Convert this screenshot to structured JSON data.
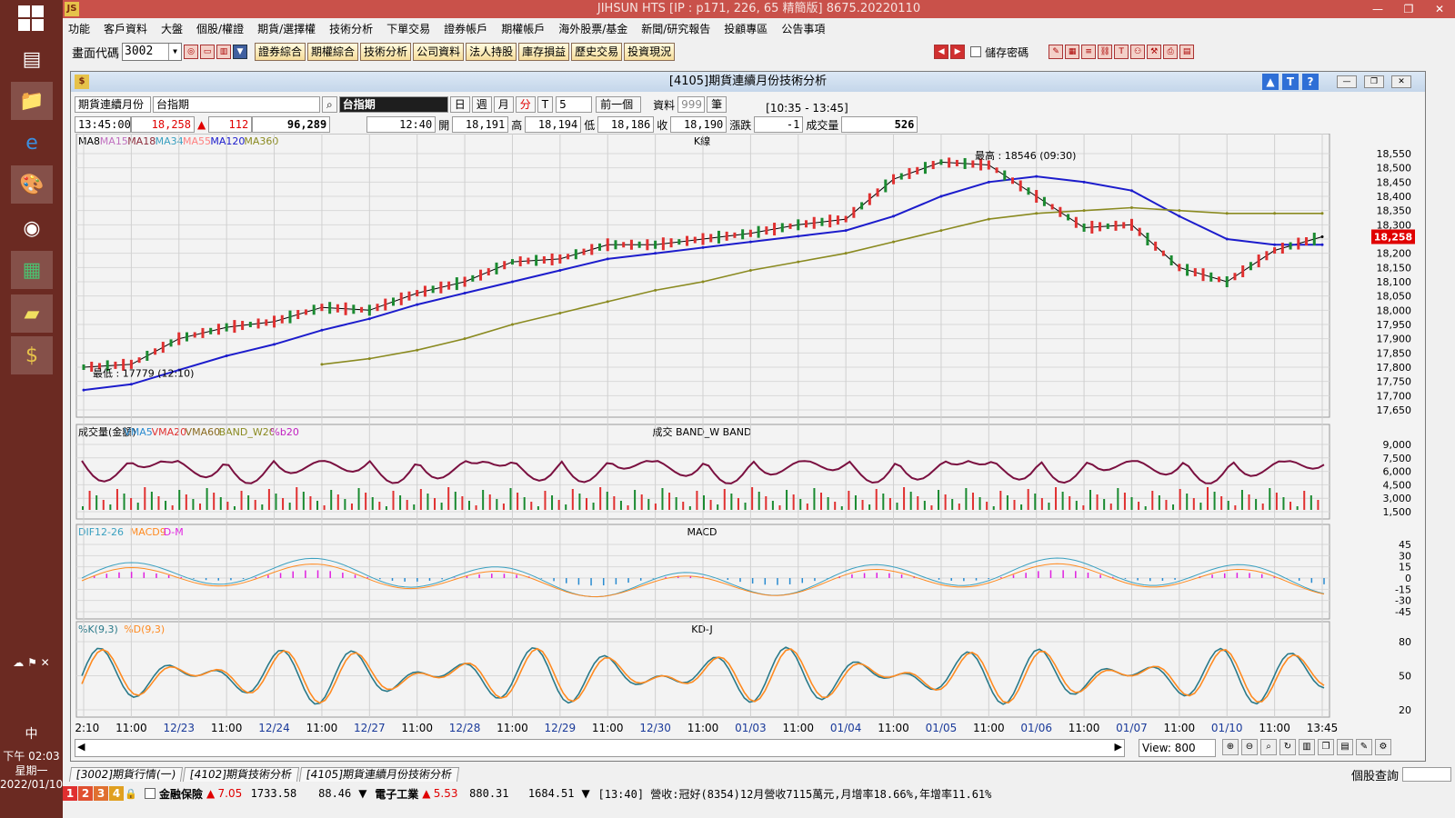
{
  "taskbar": {
    "time": "下午 02:03",
    "weekday": "星期一",
    "date": "2022/01/10",
    "ime": "中"
  },
  "app": {
    "title": "JIHSUN HTS     [IP : p171, 226, 65 精簡版] 8675.20220110",
    "logo": "JS"
  },
  "menu": [
    "功能",
    "客戶資料",
    "大盤",
    "個股/權證",
    "期貨/選擇權",
    "技術分析",
    "下單交易",
    "證券帳戶",
    "期權帳戶",
    "海外股票/基金",
    "新聞/研究報告",
    "投顧專區",
    "公告事項"
  ],
  "toolbar": {
    "code_label": "畫面代碼",
    "code_value": "3002",
    "buttons": [
      "證券綜合",
      "期權綜合",
      "技術分析",
      "公司資料",
      "法人持股",
      "庫存損益",
      "歷史交易",
      "投資現況"
    ],
    "save_pw": "儲存密碼"
  },
  "window": {
    "title": "[4105]期貨連續月份技術分析",
    "help_buttons": [
      "▲",
      "T",
      "?"
    ]
  },
  "controls": {
    "product_type": "期貨連續月份",
    "product_name": "台指期",
    "product_display": "台指期",
    "periods": [
      "日",
      "週",
      "月",
      "分",
      "T"
    ],
    "minutes": "5",
    "prev": "前一個",
    "data_label": "資料",
    "data_count": "999",
    "data_unit": "筆",
    "range": "[10:35 - 13:45]"
  },
  "quote": {
    "time": "13:45:00",
    "price": "18,258",
    "arrow": "▲",
    "change": "112",
    "volume_total": "96,289",
    "bar_time": "12:40",
    "open_label": "開",
    "open": "18,191",
    "high_label": "高",
    "high": "18,194",
    "low_label": "低",
    "low": "18,186",
    "close_label": "收",
    "close": "18,190",
    "chg_label": "漲跌",
    "chg": "-1",
    "vol_label": "成交量",
    "vol": "526"
  },
  "panels": {
    "price": {
      "title": "K線",
      "legend": [
        "MA8",
        "MA15",
        "MA18",
        "MA34",
        "MA55",
        "MA120",
        "MA360"
      ],
      "colors": [
        "#000000",
        "#c070c0",
        "#8b2a3a",
        "#3aa0c0",
        "#ff8080",
        "#1c1ccc",
        "#8a8a20"
      ],
      "high_note": "最高 : 18546 (09:30)",
      "low_note": "最低 : 17779 (12:10)",
      "last_price": "18,258",
      "yticks": [
        "18,550",
        "18,500",
        "18,450",
        "18,400",
        "18,350",
        "18,300",
        "18,250",
        "18,200",
        "18,150",
        "18,100",
        "18,050",
        "18,000",
        "17,950",
        "17,900",
        "17,850",
        "17,800",
        "17,750",
        "17,700",
        "17,650"
      ]
    },
    "volume": {
      "title": "成交   BAND_W   BAND",
      "legend": [
        "成交量(金額)",
        "VMA5",
        "VMA20",
        "VMA60",
        "BAND_W20",
        "%b20"
      ],
      "colors": [
        "#000000",
        "#2a8bd0",
        "#e03030",
        "#8a6a20",
        "#8a8a20",
        "#c020c0"
      ],
      "yticks": [
        "9,000",
        "7,500",
        "6,000",
        "4,500",
        "3,000",
        "1,500"
      ]
    },
    "macd": {
      "title": "MACD",
      "legend": [
        "DIF12-26",
        "MACD9",
        "D-M"
      ],
      "colors": [
        "#3aa0c0",
        "#ff8a20",
        "#e020e0"
      ],
      "yticks": [
        "45",
        "30",
        "15",
        "0",
        "-15",
        "-30",
        "-45"
      ]
    },
    "kd": {
      "title": "KD-J",
      "legend": [
        "%K(9,3)",
        "%D(9,3)"
      ],
      "colors": [
        "#2a7a8a",
        "#ff8a20"
      ],
      "yticks": [
        "80",
        "50",
        "20"
      ]
    }
  },
  "xaxis": [
    {
      "t": "12:10",
      "c": "#000"
    },
    {
      "t": "11:00",
      "c": "#000"
    },
    {
      "t": "12/23",
      "c": "#1a3a9a"
    },
    {
      "t": "11:00",
      "c": "#000"
    },
    {
      "t": "12/24",
      "c": "#1a3a9a"
    },
    {
      "t": "11:00",
      "c": "#000"
    },
    {
      "t": "12/27",
      "c": "#1a3a9a"
    },
    {
      "t": "11:00",
      "c": "#000"
    },
    {
      "t": "12/28",
      "c": "#1a3a9a"
    },
    {
      "t": "11:00",
      "c": "#000"
    },
    {
      "t": "12/29",
      "c": "#1a3a9a"
    },
    {
      "t": "11:00",
      "c": "#000"
    },
    {
      "t": "12/30",
      "c": "#1a3a9a"
    },
    {
      "t": "11:00",
      "c": "#000"
    },
    {
      "t": "01/03",
      "c": "#1a3a9a"
    },
    {
      "t": "11:00",
      "c": "#000"
    },
    {
      "t": "01/04",
      "c": "#1a3a9a"
    },
    {
      "t": "11:00",
      "c": "#000"
    },
    {
      "t": "01/05",
      "c": "#1a3a9a"
    },
    {
      "t": "11:00",
      "c": "#000"
    },
    {
      "t": "01/06",
      "c": "#1a3a9a"
    },
    {
      "t": "11:00",
      "c": "#000"
    },
    {
      "t": "01/07",
      "c": "#1a3a9a"
    },
    {
      "t": "11:00",
      "c": "#000"
    },
    {
      "t": "01/10",
      "c": "#1a3a9a"
    },
    {
      "t": "11:00",
      "c": "#000"
    },
    {
      "t": "13:45",
      "c": "#000"
    }
  ],
  "chart_data": {
    "type": "line",
    "x_labels": [
      "12:10",
      "11:00",
      "12/23",
      "11:00",
      "12/24",
      "11:00",
      "12/27",
      "11:00",
      "12/28",
      "11:00",
      "12/29",
      "11:00",
      "12/30",
      "11:00",
      "01/03",
      "11:00",
      "01/04",
      "11:00",
      "01/05",
      "11:00",
      "01/06",
      "11:00",
      "01/07",
      "11:00",
      "01/10",
      "11:00",
      "13:45"
    ],
    "series": [
      {
        "name": "MA8",
        "values": [
          17800,
          17810,
          17900,
          17940,
          17960,
          18010,
          18000,
          18060,
          18100,
          18170,
          18180,
          18230,
          18230,
          18250,
          18270,
          18300,
          18320,
          18460,
          18520,
          18510,
          18400,
          18290,
          18300,
          18150,
          18100,
          18210,
          18258
        ]
      },
      {
        "name": "MA120",
        "values": [
          17720,
          17740,
          17790,
          17840,
          17880,
          17930,
          17970,
          18020,
          18060,
          18100,
          18140,
          18180,
          18200,
          18220,
          18240,
          18260,
          18280,
          18330,
          18400,
          18450,
          18470,
          18450,
          18420,
          18330,
          18250,
          18230,
          18230
        ]
      },
      {
        "name": "MA360",
        "values": [
          null,
          null,
          null,
          null,
          null,
          17810,
          17830,
          17860,
          17900,
          17950,
          17990,
          18030,
          18070,
          18100,
          18140,
          18170,
          18200,
          18240,
          18280,
          18320,
          18340,
          18350,
          18360,
          18350,
          18340,
          18340,
          18340
        ]
      }
    ],
    "ylim": [
      17650,
      18550
    ]
  },
  "bottom": {
    "view_label": "View:",
    "view_value": "800",
    "tabs": [
      "[3002]期貨行情(一)",
      "[4102]期貨技術分析",
      "[4105]期貨連續月份技術分析"
    ],
    "query": "個股查詢"
  },
  "status": {
    "nums": [
      "1",
      "2",
      "3",
      "4"
    ],
    "ind1": "金融保險",
    "ind1_chg": "7.05",
    "ind1_val": "1733.58",
    "ind1_v2": "88.46",
    "ind2": "電子工業",
    "ind2_chg": "5.53",
    "ind2_val": "880.31",
    "ind2_v2": "1684.51",
    "news": "[13:40] 營收:冠好(8354)12月營收7115萬元,月增率18.66%,年增率11.61%"
  }
}
